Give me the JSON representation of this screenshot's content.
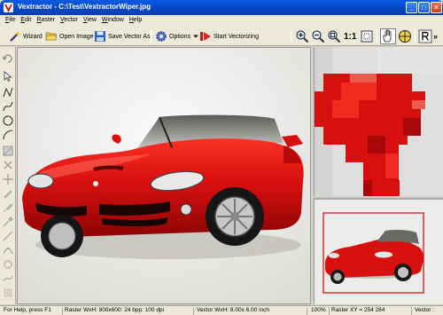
{
  "window": {
    "title": "Vextractor - C:\\Test\\VextractorWiper.jpg",
    "minimize_label": "_",
    "maximize_label": "□",
    "close_label": "✕"
  },
  "menu": [
    {
      "key": "F",
      "rest": "ile"
    },
    {
      "key": "E",
      "rest": "dit"
    },
    {
      "key": "R",
      "rest": "aster"
    },
    {
      "key": "V",
      "rest": "ector"
    },
    {
      "key": "V",
      "rest": "iew"
    },
    {
      "key": "W",
      "rest": "indow"
    },
    {
      "key": "H",
      "rest": "elp"
    }
  ],
  "toolbar": {
    "wizard": "Wizard",
    "open_image": "Open Image",
    "save_vector": "Save Vector As",
    "options": "Options",
    "start": "Start Vectorizing",
    "one_to_one": "1:1",
    "more": "»"
  },
  "status": {
    "help": "For Help, press F1",
    "raster_info": "Raster WxH: 800x600: 24 bpp: 100 dpi",
    "vector_info": "Vector WxH:  8.00x 6.00 inch",
    "zoom": "100%",
    "raster_xy": "Raster XY =  254  284",
    "vector_label": "Vector :"
  },
  "colors": {
    "titlebar": "#0746c2",
    "car_red": "#d80f0f",
    "nav_frame": "#e00000"
  },
  "icons": [
    "app-icon",
    "wand-icon",
    "folder-open-icon",
    "floppy-icon",
    "gear-icon",
    "start-icon",
    "zoom-in-icon",
    "zoom-out-icon",
    "zoom-fit-icon",
    "hand-icon",
    "target-icon",
    "r-icon"
  ]
}
